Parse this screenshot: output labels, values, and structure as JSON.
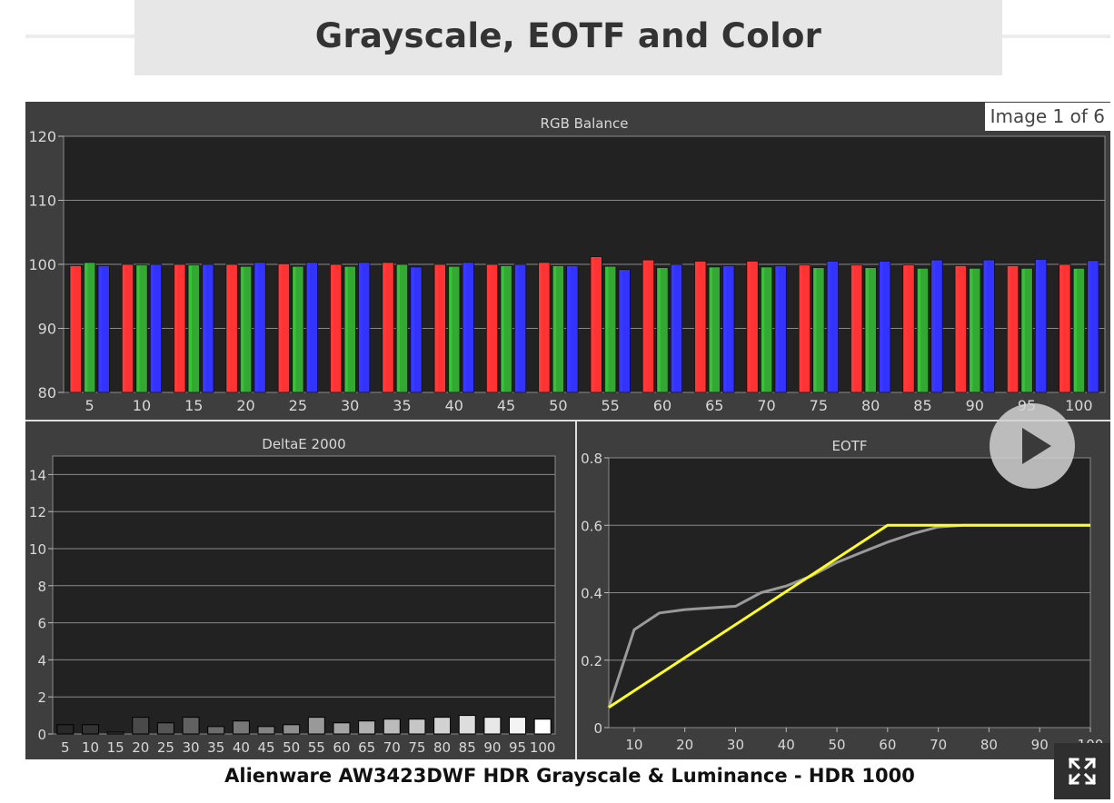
{
  "page": {
    "title": "Grayscale, EOTF and Color",
    "image_counter": "Image 1 of 6",
    "caption": "Alienware AW3423DWF HDR Grayscale & Luminance - HDR 1000",
    "icons": {
      "play": "play-icon",
      "expand": "expand-icon"
    }
  },
  "chart_data": [
    {
      "type": "bar",
      "title": "RGB Balance",
      "ylim": [
        80,
        120
      ],
      "yticks": [
        80,
        90,
        100,
        110,
        120
      ],
      "categories": [
        "5",
        "10",
        "15",
        "20",
        "25",
        "30",
        "35",
        "40",
        "45",
        "50",
        "55",
        "60",
        "65",
        "70",
        "75",
        "80",
        "85",
        "90",
        "95",
        "100"
      ],
      "colors": [
        "#ff3333",
        "#33a833",
        "#3333ff"
      ],
      "series": [
        {
          "values": [
            99.8,
            100.0,
            100.0,
            100.0,
            100.1,
            100.0,
            100.3,
            100.0,
            100.0,
            100.3,
            101.2,
            100.7,
            100.5,
            100.5,
            99.9,
            99.9,
            99.9,
            99.8,
            99.8,
            100.0
          ]
        },
        {
          "values": [
            100.3,
            99.9,
            99.9,
            99.7,
            99.7,
            99.7,
            100.0,
            99.7,
            99.8,
            99.8,
            99.7,
            99.5,
            99.6,
            99.6,
            99.5,
            99.5,
            99.4,
            99.4,
            99.4,
            99.4
          ]
        },
        {
          "values": [
            99.8,
            100.0,
            100.0,
            100.3,
            100.3,
            100.3,
            99.6,
            100.3,
            100.0,
            99.8,
            99.2,
            100.0,
            99.8,
            99.8,
            100.5,
            100.5,
            100.7,
            100.7,
            100.8,
            100.6
          ]
        }
      ]
    },
    {
      "type": "bar",
      "title": "DeltaE 2000",
      "ylim": [
        0,
        15
      ],
      "yticks": [
        0,
        2,
        4,
        6,
        8,
        10,
        12,
        14
      ],
      "categories": [
        "5",
        "10",
        "15",
        "20",
        "25",
        "30",
        "35",
        "40",
        "45",
        "50",
        "55",
        "60",
        "65",
        "70",
        "75",
        "80",
        "85",
        "90",
        "95",
        "100"
      ],
      "values": [
        0.5,
        0.5,
        0.1,
        0.9,
        0.6,
        0.9,
        0.4,
        0.7,
        0.4,
        0.5,
        0.9,
        0.6,
        0.7,
        0.8,
        0.8,
        0.9,
        1.0,
        0.9,
        0.9,
        0.8
      ]
    },
    {
      "type": "line",
      "title": "EOTF",
      "xlim": [
        5,
        100
      ],
      "ylim": [
        0,
        0.8
      ],
      "xticks": [
        10,
        20,
        30,
        40,
        50,
        60,
        70,
        80,
        90,
        100
      ],
      "yticks": [
        "0",
        "0.2",
        "0.4",
        "0.6",
        "0.8"
      ],
      "series": [
        {
          "color": "#ffff22",
          "x": [
            5,
            60,
            100
          ],
          "y": [
            0.06,
            0.6,
            0.6
          ]
        },
        {
          "color": "#9a9a9a",
          "x": [
            5,
            10,
            15,
            20,
            25,
            30,
            35,
            40,
            45,
            50,
            55,
            60,
            65,
            70,
            75,
            80,
            100
          ],
          "y": [
            0.06,
            0.29,
            0.34,
            0.35,
            0.355,
            0.36,
            0.4,
            0.42,
            0.45,
            0.49,
            0.52,
            0.55,
            0.575,
            0.595,
            0.6,
            0.6,
            0.6
          ]
        }
      ]
    }
  ]
}
